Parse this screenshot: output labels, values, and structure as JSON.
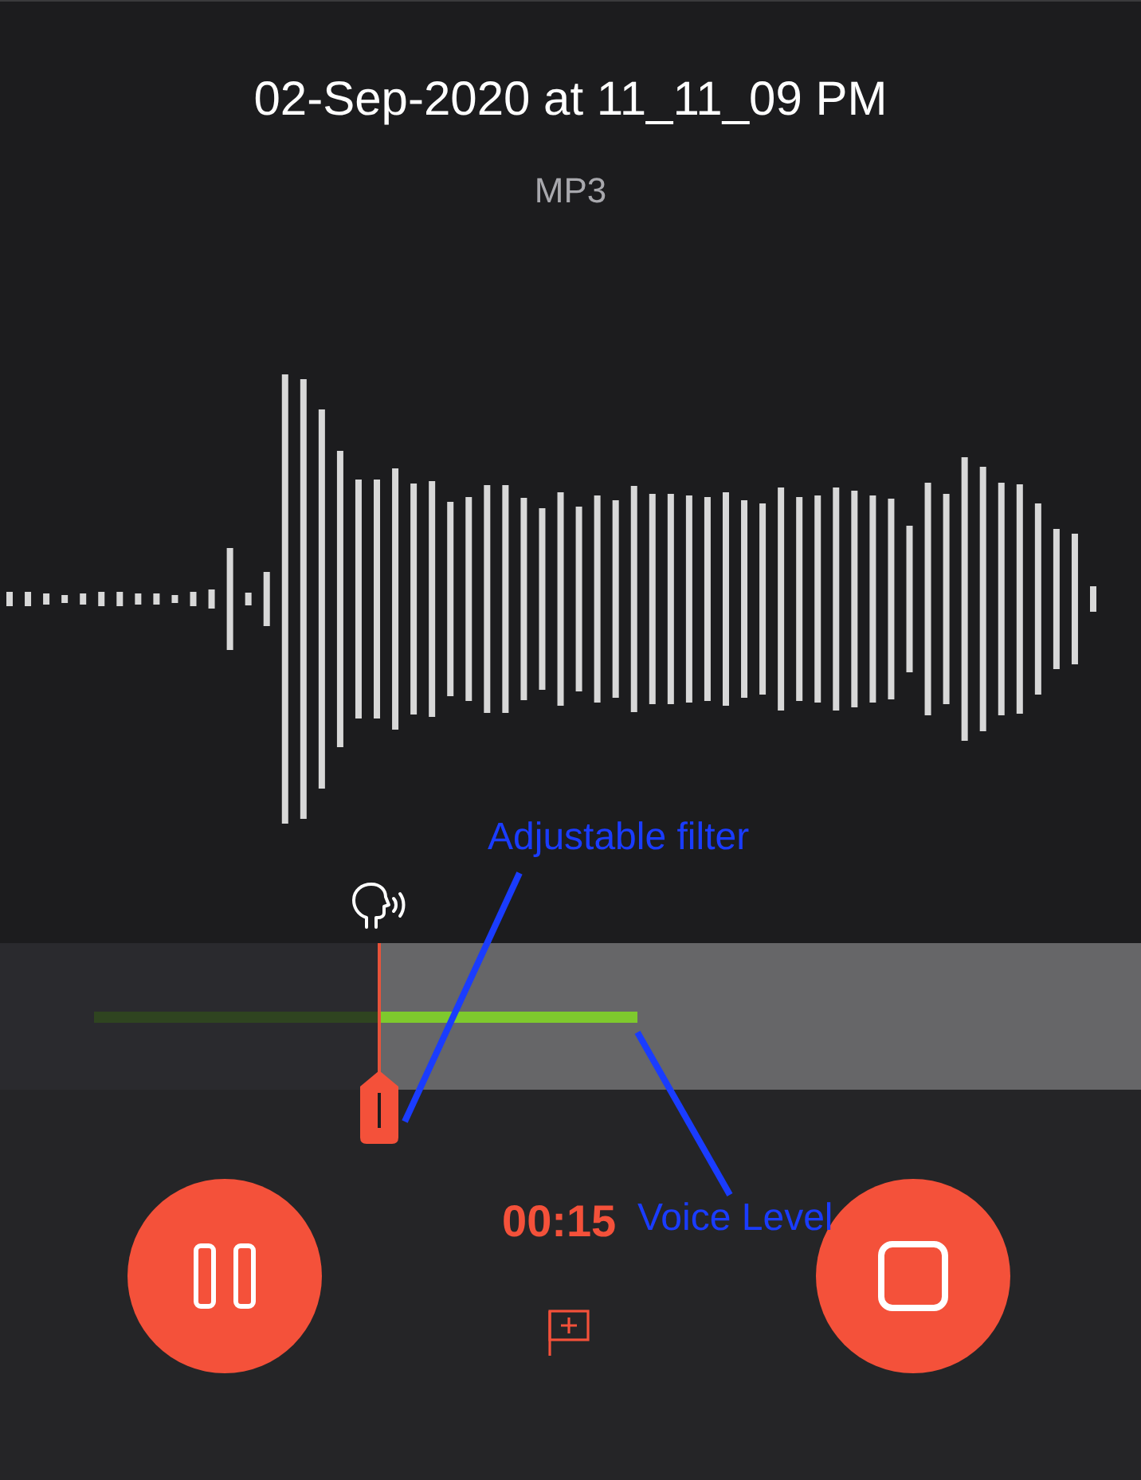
{
  "recording": {
    "title": "02-Sep-2020 at 11_11_09 PM",
    "format": "MP3"
  },
  "meter": {
    "filter": {
      "level": 0.3
    }
  },
  "controls": {
    "elapsed": "00:15"
  },
  "annotations": [
    {
      "label": "Adjustable filter"
    },
    {
      "label": "Voice Level"
    }
  ]
}
